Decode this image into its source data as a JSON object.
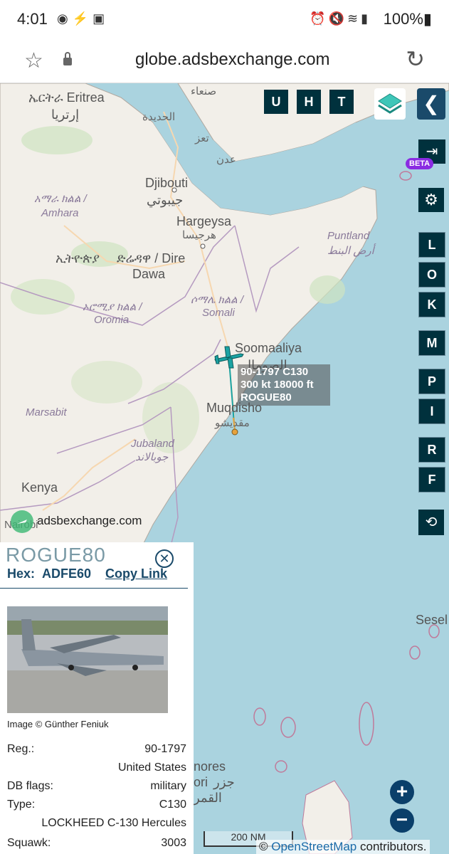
{
  "statusbar": {
    "time": "4:01",
    "left_icons": [
      "location-icon",
      "plug-icon",
      "image-icon"
    ],
    "right_icons": [
      "alarm-icon",
      "mute-icon",
      "wifi-icon",
      "signal-icon"
    ],
    "battery": "100%"
  },
  "browser": {
    "url": "globe.adsbexchange.com"
  },
  "map": {
    "labels": [
      {
        "id": "eritrea",
        "text": "ኤርትራ Eritrea"
      },
      {
        "id": "eritrea_ar",
        "text": "إرتريا"
      },
      {
        "id": "sanaa",
        "text": "صنعاء"
      },
      {
        "id": "hudaydah",
        "text": "الحديدة"
      },
      {
        "id": "taiz",
        "text": "تعز"
      },
      {
        "id": "aden",
        "text": "عدن"
      },
      {
        "id": "djibouti",
        "text": "Djibouti"
      },
      {
        "id": "djibouti_ar",
        "text": "جيبوتي"
      },
      {
        "id": "amhara",
        "text": "አማራ ክልል /"
      },
      {
        "id": "amhara2",
        "text": "Amhara"
      },
      {
        "id": "hargeysa",
        "text": "Hargeysa"
      },
      {
        "id": "hargeysa_ar",
        "text": "هرجيسا"
      },
      {
        "id": "puntland",
        "text": "Puntland"
      },
      {
        "id": "puntland_ar",
        "text": "أرض البنط"
      },
      {
        "id": "ethiopia",
        "text": "ኢትዮጵያ"
      },
      {
        "id": "diredawa",
        "text": "ድሬዳዋ / Dire"
      },
      {
        "id": "diredawa2",
        "text": "Dawa"
      },
      {
        "id": "oromia",
        "text": "ኦሮሚያ ክልል /"
      },
      {
        "id": "oromia2",
        "text": "Oromia"
      },
      {
        "id": "somali",
        "text": "ሶማሌ ክልል /"
      },
      {
        "id": "somali2",
        "text": "Somali"
      },
      {
        "id": "soomaaliya",
        "text": "Soomaaliya"
      },
      {
        "id": "soomaaliya_ar",
        "text": "الصومال"
      },
      {
        "id": "marsabit",
        "text": "Marsabit"
      },
      {
        "id": "muqdisho",
        "text": "Muqdisho"
      },
      {
        "id": "muqdisho_ar",
        "text": "مقديشو"
      },
      {
        "id": "jubaland",
        "text": "Jubaland"
      },
      {
        "id": "jubaland_ar",
        "text": "جوبالاند"
      },
      {
        "id": "kenya",
        "text": "Kenya"
      },
      {
        "id": "nairobi",
        "text": "Nairobi"
      },
      {
        "id": "comoros",
        "text": "nores"
      },
      {
        "id": "comoros_ar",
        "text": "جزر"
      },
      {
        "id": "comoros_ar2",
        "text": "القمر"
      },
      {
        "id": "comoros_ar3",
        "text": "ori"
      },
      {
        "id": "seychelles",
        "text": "Sesel"
      }
    ],
    "aircraft": {
      "line1": "90-1797 C130",
      "line2": "300 kt  18000 ft",
      "line3": "ROGUE80",
      "color": "#1ba3a3"
    },
    "top_buttons": [
      "U",
      "H",
      "T"
    ],
    "side_buttons": [
      "L",
      "O",
      "K",
      "M",
      "P",
      "I",
      "R",
      "F"
    ],
    "beta_label": "BETA",
    "site_text": "adsbexchange.com",
    "scale_label": "200 NM",
    "attribution_prefix": "© ",
    "attribution_link": "OpenStreetMap",
    "attribution_suffix": " contributors."
  },
  "panel": {
    "callsign": "ROGUE80",
    "hex_label": "Hex:",
    "hex_value": "ADFE60",
    "copy_link": "Copy Link",
    "photo_credit": "Image © Günther Feniuk",
    "rows": [
      {
        "label": "Reg.:",
        "value": "90-1797"
      },
      {
        "label": "",
        "value": "United States"
      },
      {
        "label": "DB flags:",
        "value": "military"
      },
      {
        "label": "Type:",
        "value": "C130"
      },
      {
        "label": "",
        "value": "LOCKHEED C-130 Hercules"
      },
      {
        "label": "Squawk:",
        "value": "3003"
      }
    ]
  },
  "colors": {
    "sea": "#aad3df",
    "land": "#f2efe9",
    "button_bg": "#00313d",
    "accent": "#1a4a6a"
  }
}
